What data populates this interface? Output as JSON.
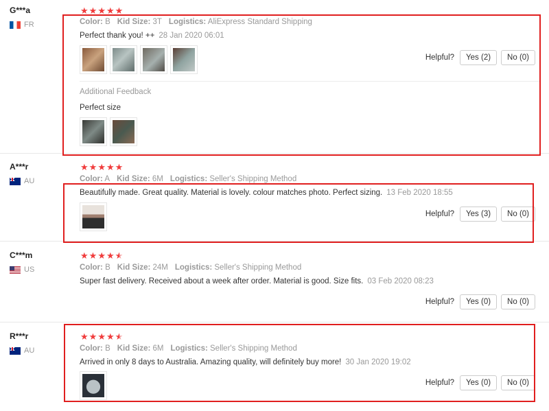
{
  "helpful_label": "Helpful?",
  "attr_labels": {
    "color": "Color:",
    "size": "Kid Size:",
    "logistics": "Logistics:"
  },
  "additional_feedback_title": "Additional Feedback",
  "reviews": [
    {
      "user": "G***a",
      "country": "FR",
      "rating": 5,
      "color": "B",
      "size": "3T",
      "logistics": "AliExpress Standard Shipping",
      "text": "Perfect thank you! ++",
      "date": "28 Jan 2020 06:01",
      "yes": "Yes (2)",
      "no": "No (0)",
      "additional_text": "Perfect size"
    },
    {
      "user": "A***r",
      "country": "AU",
      "rating": 5,
      "color": "A",
      "size": "6M",
      "logistics": "Seller's Shipping Method",
      "text": "Beautifully made. Great quality. Material is lovely. colour matches photo. Perfect sizing.",
      "date": "13 Feb 2020 18:55",
      "yes": "Yes (3)",
      "no": "No (0)"
    },
    {
      "user": "C***m",
      "country": "US",
      "rating": 4.5,
      "color": "B",
      "size": "24M",
      "logistics": "Seller's Shipping Method",
      "text": "Super fast delivery. Received about a week after order. Material is good. Size fits.",
      "date": "03 Feb 2020 08:23",
      "yes": "Yes (0)",
      "no": "No (0)"
    },
    {
      "user": "R***r",
      "country": "AU",
      "rating": 4.5,
      "color": "B",
      "size": "6M",
      "logistics": "Seller's Shipping Method",
      "text": "Arrived in only 8 days to Australia. Amazing quality, will definitely buy more!",
      "date": "30 Jan 2020 19:02",
      "yes": "Yes (0)",
      "no": "No (0)"
    }
  ],
  "colors": {
    "star": "#f03c3c",
    "highlight": "#e01e1e"
  }
}
